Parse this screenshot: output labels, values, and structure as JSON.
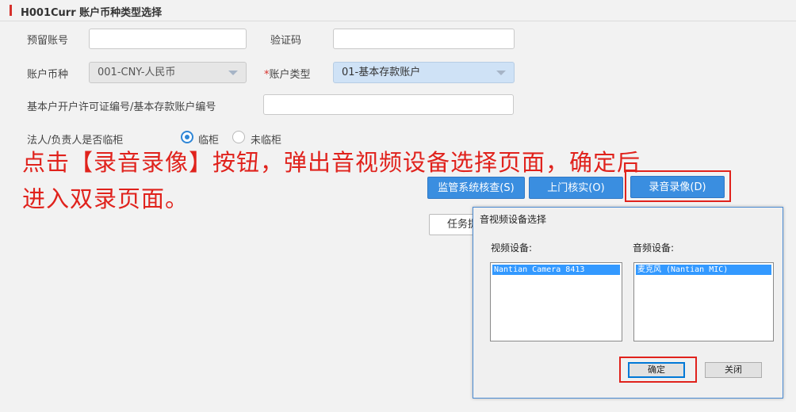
{
  "page": {
    "title": "H001Curr 账户币种类型选择"
  },
  "form": {
    "reserved_account_label": "预留账号",
    "reserved_account_value": "",
    "verify_code_label": "验证码",
    "verify_code_value": "",
    "currency_label": "账户币种",
    "currency_value": "001-CNY-人民币",
    "account_type_required": "*",
    "account_type_label": "账户类型",
    "account_type_value": "01-基本存款账户",
    "license_label": "基本户开户许可证编号/基本存款账户编号",
    "license_value": "",
    "present_label": "法人/负责人是否临柜",
    "present_yes": "临柜",
    "present_no": "未临柜"
  },
  "annotation": {
    "line1": "点击【录音录像】按钮，弹出音视频设备选择页面，确定后",
    "line2": "进入双录页面。"
  },
  "buttons": {
    "supervise": "监管系统核查(S)",
    "onsite": "上门核实(O)",
    "record": "录音录像(D)",
    "task": "任务提"
  },
  "dialog": {
    "title": "音视频设备选择",
    "video_label": "视频设备:",
    "audio_label": "音频设备:",
    "video_items": [
      "Nantian Camera 8413"
    ],
    "audio_items": [
      "麦克风 (Nantian MIC)"
    ],
    "ok": "确定",
    "close": "关闭"
  },
  "colors": {
    "accent_red": "#e0221c",
    "button_blue": "#3a8ee0",
    "selection_blue": "#3399ff"
  }
}
